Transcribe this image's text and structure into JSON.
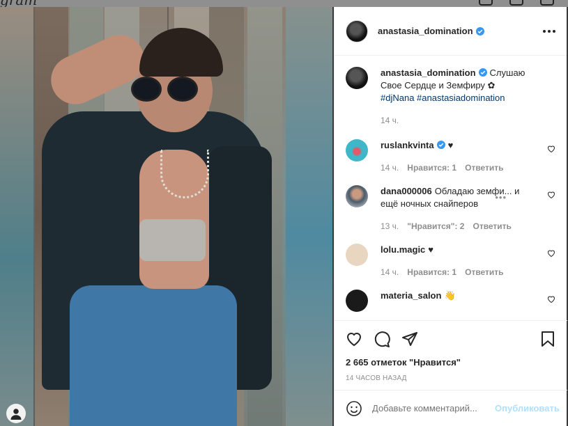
{
  "header": {
    "logo": "gram"
  },
  "post": {
    "author": "anastasia_domination",
    "caption_text": "Слушаю Свое Сердце и Земфиру ✿",
    "caption_tags": "#djNana #anastasiadomination",
    "caption_time": "14 ч.",
    "likes": "2 665 отметок \"Нравится\"",
    "posted_ago": "14 ЧАСОВ НАЗАД"
  },
  "comments": [
    {
      "user": "ruslankvinta",
      "text": "♥",
      "time": "14 ч.",
      "likes": "Нравится: 1",
      "reply": "Ответить"
    },
    {
      "user": "dana000006",
      "text": "Обладаю земфи... и ещё ночных снайперов",
      "time": "13 ч.",
      "likes": "\"Нравится\": 2",
      "reply": "Ответить"
    },
    {
      "user": "lolu.magic",
      "text": "♥",
      "time": "14 ч.",
      "likes": "Нравится: 1",
      "reply": "Ответить"
    },
    {
      "user": "materia_salon",
      "text": "👋"
    }
  ],
  "add_comment": {
    "placeholder": "Добавьте комментарий...",
    "post_label": "Опубликовать"
  },
  "colors": {
    "link": "#00376b",
    "verified": "#3897f0",
    "muted": "#8e8e8e",
    "post_disabled": "#b2dffc"
  }
}
